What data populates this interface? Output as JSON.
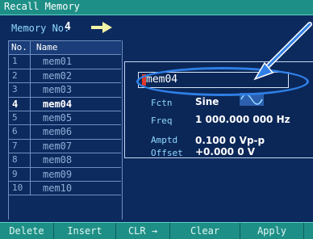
{
  "title": "Recall Memory",
  "memory_no": {
    "label": "Memory No.",
    "value": "4",
    "arrow_icon": "arrow-right-icon",
    "arrow_color": "#f1f3a6"
  },
  "table": {
    "headers": [
      "No.",
      "Name"
    ],
    "rows": [
      {
        "no": "1",
        "name": "mem01"
      },
      {
        "no": "2",
        "name": "mem02"
      },
      {
        "no": "3",
        "name": "mem03"
      },
      {
        "no": "4",
        "name": "mem04"
      },
      {
        "no": "5",
        "name": "mem05"
      },
      {
        "no": "6",
        "name": "mem06"
      },
      {
        "no": "7",
        "name": "mem07"
      },
      {
        "no": "8",
        "name": "mem08"
      },
      {
        "no": "9",
        "name": "mem09"
      },
      {
        "no": "10",
        "name": "mem10"
      }
    ],
    "selected_index": 3
  },
  "detail": {
    "name_value": "mem04",
    "fctn_label": "Fctn",
    "fctn_value": "Sine",
    "freq_label": "Freq",
    "freq_value": "1 000.000 000 Hz",
    "amptd_label": "Amptd",
    "amptd_value": "0.100 0 Vp-p",
    "offset_label": "Offset",
    "offset_value": "+0.000 0 V",
    "wave_icon": "sine-wave-icon"
  },
  "softkeys": [
    "Delete",
    "Insert",
    "CLR →",
    "Clear",
    "Apply",
    ""
  ],
  "colors": {
    "background": "#0c2a5e",
    "bar": "#1e8f86",
    "highlight": "#2f7fe6",
    "cursor": "#e03a2a"
  }
}
